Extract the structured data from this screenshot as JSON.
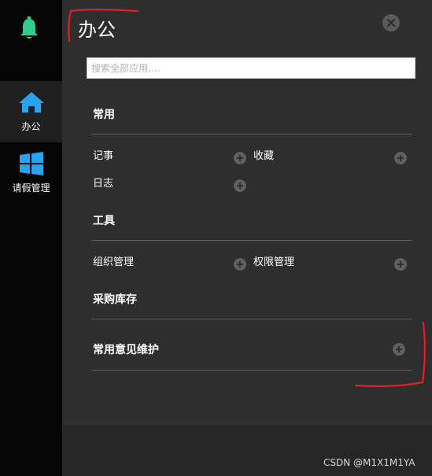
{
  "sidebar": {
    "items": [
      {
        "label": "办公",
        "icon": "home-icon"
      },
      {
        "label": "请假管理",
        "icon": "windows-icon"
      }
    ]
  },
  "panel": {
    "title": "办公",
    "search_placeholder": "搜索全部应用....",
    "sections": [
      {
        "title": "常用",
        "items": [
          "记事",
          "收藏",
          "日志"
        ]
      },
      {
        "title": "工具",
        "items": [
          "组织管理",
          "权限管理"
        ]
      },
      {
        "title": "采购库存",
        "items": []
      },
      {
        "title": "常用意见维护",
        "items": []
      }
    ]
  },
  "watermark": "CSDN @M1X1M1YA",
  "colors": {
    "sidebar_bg": "#050505",
    "panel_bg": "#2e2e2e",
    "accent_green": "#2ecc8f",
    "accent_blue": "#29a3f0",
    "annotation_red": "#e0202a"
  }
}
